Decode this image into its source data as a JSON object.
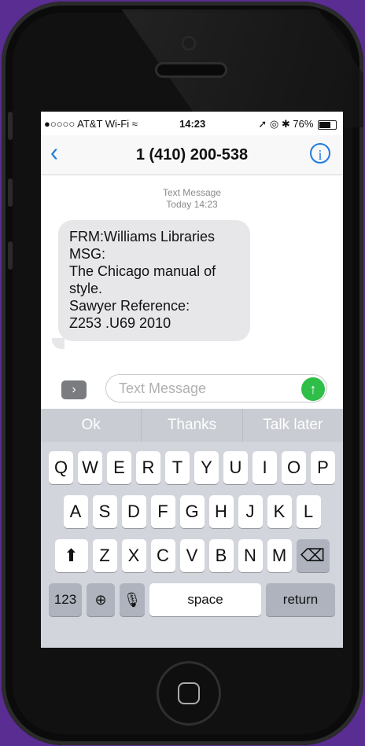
{
  "status_bar": {
    "carrier": "●○○○○ AT&T Wi-Fi ≈",
    "time": "14:23",
    "indicators": "➚ ◎ ✱ 76%",
    "battery_percent": 76
  },
  "nav": {
    "contact": "1 (410) 200-538",
    "back_icon": "chevron-left-icon",
    "info_icon": "info-icon"
  },
  "conversation": {
    "meta_label": "Text Message",
    "meta_time": "Today 14:23",
    "message_lines": [
      "FRM:Williams Libraries",
      "MSG:",
      "The Chicago manual of",
      "style.",
      "Sawyer Reference:",
      "Z253 .U69 2010"
    ]
  },
  "compose": {
    "placeholder": "Text Message",
    "apps_icon": "apps-chevron-icon",
    "send_icon": "send-arrow-icon"
  },
  "keyboard": {
    "suggestions": [
      "Ok",
      "Thanks",
      "Talk later"
    ],
    "row1": [
      "Q",
      "W",
      "E",
      "R",
      "T",
      "Y",
      "U",
      "I",
      "O",
      "P"
    ],
    "row2": [
      "A",
      "S",
      "D",
      "F",
      "G",
      "H",
      "J",
      "K",
      "L"
    ],
    "row3": [
      "Z",
      "X",
      "C",
      "V",
      "B",
      "N",
      "M"
    ],
    "numbers": "123",
    "space": "space",
    "return": "return"
  },
  "colors": {
    "background": "#5a2d92",
    "accent": "#1f7ae0",
    "send": "#2fbf48",
    "bubble": "#e7e7ea"
  }
}
